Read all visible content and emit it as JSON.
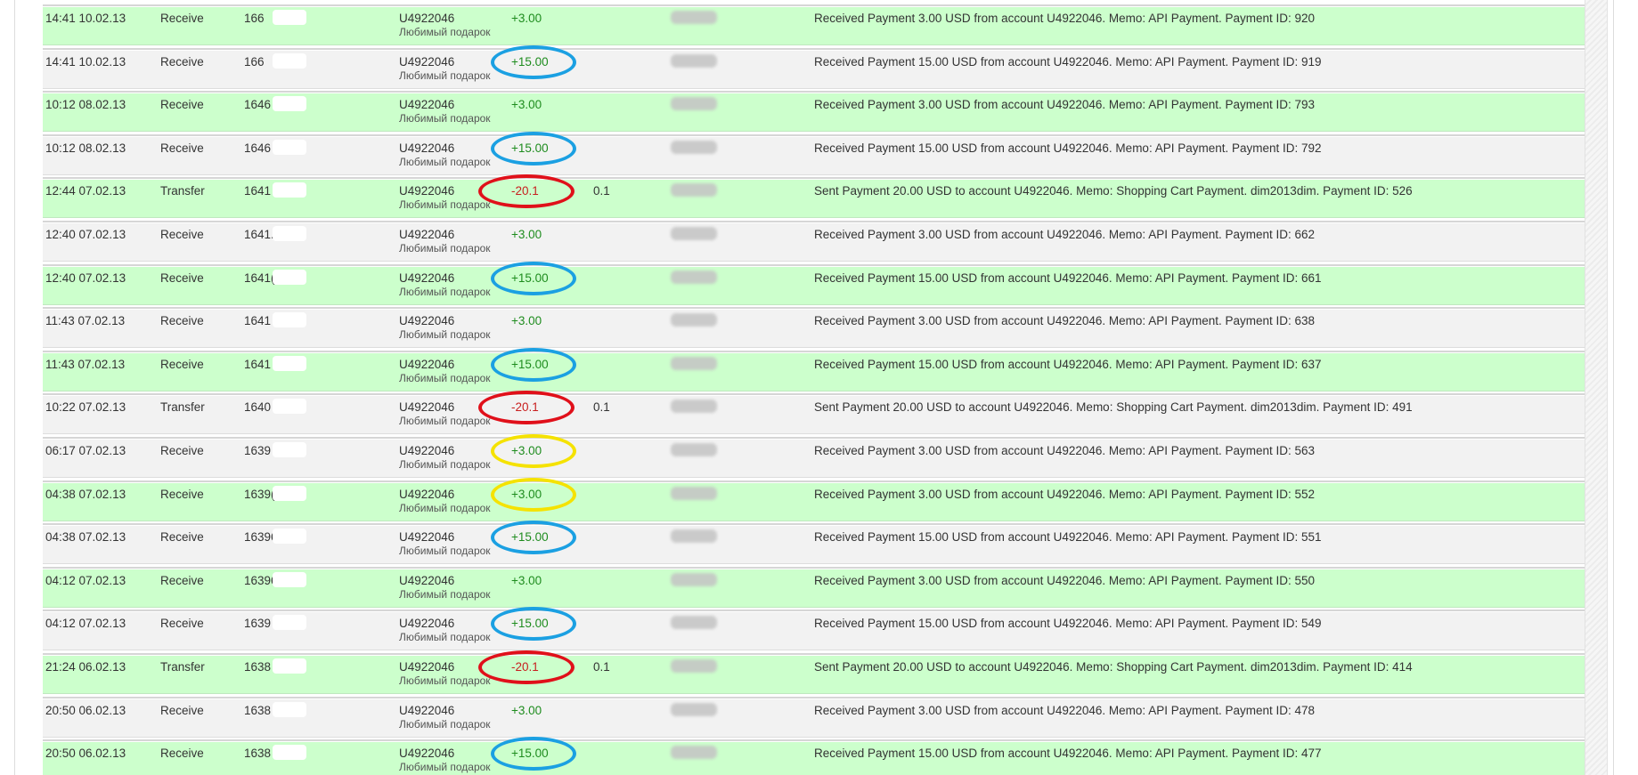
{
  "colors": {
    "row_green": "#ccffcc",
    "row_gray": "#f2f2f2",
    "amount_positive": "#1e8c1e",
    "amount_negative": "#c81e1e",
    "circle_blue": "#1ba0e2",
    "circle_red": "#e0101a",
    "circle_yellow": "#f5e200"
  },
  "rows": [
    {
      "time": "14:41 10.02.13",
      "type": "Receive",
      "batch": "166",
      "account": "U4922046",
      "name": "Любимый подарок",
      "amount": "+3.00",
      "amount_sign": "pos",
      "fee": "",
      "memo": "Received Payment 3.00 USD from account U4922046. Memo: API Payment. Payment ID: 920",
      "circle": "",
      "shade": "green"
    },
    {
      "time": "14:41 10.02.13",
      "type": "Receive",
      "batch": "166",
      "account": "U4922046",
      "name": "Любимый подарок",
      "amount": "+15.00",
      "amount_sign": "pos",
      "fee": "",
      "memo": "Received Payment 15.00 USD from account U4922046. Memo: API Payment. Payment ID: 919",
      "circle": "blue",
      "shade": "gray"
    },
    {
      "time": "10:12 08.02.13",
      "type": "Receive",
      "batch": "1646",
      "account": "U4922046",
      "name": "Любимый подарок",
      "amount": "+3.00",
      "amount_sign": "pos",
      "fee": "",
      "memo": "Received Payment 3.00 USD from account U4922046. Memo: API Payment. Payment ID: 793",
      "circle": "",
      "shade": "green"
    },
    {
      "time": "10:12 08.02.13",
      "type": "Receive",
      "batch": "1646",
      "account": "U4922046",
      "name": "Любимый подарок",
      "amount": "+15.00",
      "amount_sign": "pos",
      "fee": "",
      "memo": "Received Payment 15.00 USD from account U4922046. Memo: API Payment. Payment ID: 792",
      "circle": "blue",
      "shade": "gray"
    },
    {
      "time": "12:44 07.02.13",
      "type": "Transfer",
      "batch": "1641",
      "account": "U4922046",
      "name": "Любимый подарок",
      "amount": "-20.1",
      "amount_sign": "neg",
      "fee": "0.1",
      "memo": "Sent Payment 20.00 USD to account U4922046. Memo: Shopping Cart Payment. dim2013dim. Payment ID: 526",
      "circle": "red",
      "shade": "green"
    },
    {
      "time": "12:40 07.02.13",
      "type": "Receive",
      "batch": "1641.",
      "account": "U4922046",
      "name": "Любимый подарок",
      "amount": "+3.00",
      "amount_sign": "pos",
      "fee": "",
      "memo": "Received Payment 3.00 USD from account U4922046. Memo: API Payment. Payment ID: 662",
      "circle": "",
      "shade": "gray"
    },
    {
      "time": "12:40 07.02.13",
      "type": "Receive",
      "batch": "1641(",
      "account": "U4922046",
      "name": "Любимый подарок",
      "amount": "+15.00",
      "amount_sign": "pos",
      "fee": "",
      "memo": "Received Payment 15.00 USD from account U4922046. Memo: API Payment. Payment ID: 661",
      "circle": "blue",
      "shade": "green"
    },
    {
      "time": "11:43 07.02.13",
      "type": "Receive",
      "batch": "1641",
      "account": "U4922046",
      "name": "Любимый подарок",
      "amount": "+3.00",
      "amount_sign": "pos",
      "fee": "",
      "memo": "Received Payment 3.00 USD from account U4922046. Memo: API Payment. Payment ID: 638",
      "circle": "",
      "shade": "gray"
    },
    {
      "time": "11:43 07.02.13",
      "type": "Receive",
      "batch": "1641",
      "account": "U4922046",
      "name": "Любимый подарок",
      "amount": "+15.00",
      "amount_sign": "pos",
      "fee": "",
      "memo": "Received Payment 15.00 USD from account U4922046. Memo: API Payment. Payment ID: 637",
      "circle": "blue",
      "shade": "green"
    },
    {
      "time": "10:22 07.02.13",
      "type": "Transfer",
      "batch": "1640",
      "account": "U4922046",
      "name": "Любимый подарок",
      "amount": "-20.1",
      "amount_sign": "neg",
      "fee": "0.1",
      "memo": "Sent Payment 20.00 USD to account U4922046. Memo: Shopping Cart Payment. dim2013dim. Payment ID: 491",
      "circle": "red",
      "shade": "gray"
    },
    {
      "time": "06:17 07.02.13",
      "type": "Receive",
      "batch": "1639",
      "account": "U4922046",
      "name": "Любимый подарок",
      "amount": "+3.00",
      "amount_sign": "pos",
      "fee": "",
      "memo": "Received Payment 3.00 USD from account U4922046. Memo: API Payment. Payment ID: 563",
      "circle": "yellow",
      "shade": "gray"
    },
    {
      "time": "04:38 07.02.13",
      "type": "Receive",
      "batch": "1639(",
      "account": "U4922046",
      "name": "Любимый подарок",
      "amount": "+3.00",
      "amount_sign": "pos",
      "fee": "",
      "memo": "Received Payment 3.00 USD from account U4922046. Memo: API Payment. Payment ID: 552",
      "circle": "yellow",
      "shade": "green"
    },
    {
      "time": "04:38 07.02.13",
      "type": "Receive",
      "batch": "16396",
      "account": "U4922046",
      "name": "Любимый подарок",
      "amount": "+15.00",
      "amount_sign": "pos",
      "fee": "",
      "memo": "Received Payment 15.00 USD from account U4922046. Memo: API Payment. Payment ID: 551",
      "circle": "blue",
      "shade": "gray"
    },
    {
      "time": "04:12 07.02.13",
      "type": "Receive",
      "batch": "16396",
      "account": "U4922046",
      "name": "Любимый подарок",
      "amount": "+3.00",
      "amount_sign": "pos",
      "fee": "",
      "memo": "Received Payment 3.00 USD from account U4922046. Memo: API Payment. Payment ID: 550",
      "circle": "",
      "shade": "green"
    },
    {
      "time": "04:12 07.02.13",
      "type": "Receive",
      "batch": "1639",
      "account": "U4922046",
      "name": "Любимый подарок",
      "amount": "+15.00",
      "amount_sign": "pos",
      "fee": "",
      "memo": "Received Payment 15.00 USD from account U4922046. Memo: API Payment. Payment ID: 549",
      "circle": "blue",
      "shade": "gray"
    },
    {
      "time": "21:24 06.02.13",
      "type": "Transfer",
      "batch": "1638",
      "account": "U4922046",
      "name": "Любимый подарок",
      "amount": "-20.1",
      "amount_sign": "neg",
      "fee": "0.1",
      "memo": "Sent Payment 20.00 USD to account U4922046. Memo: Shopping Cart Payment. dim2013dim. Payment ID: 414",
      "circle": "red",
      "shade": "green"
    },
    {
      "time": "20:50 06.02.13",
      "type": "Receive",
      "batch": "1638",
      "account": "U4922046",
      "name": "Любимый подарок",
      "amount": "+3.00",
      "amount_sign": "pos",
      "fee": "",
      "memo": "Received Payment 3.00 USD from account U4922046. Memo: API Payment. Payment ID: 478",
      "circle": "",
      "shade": "gray"
    },
    {
      "time": "20:50 06.02.13",
      "type": "Receive",
      "batch": "1638",
      "account": "U4922046",
      "name": "Любимый подарок",
      "amount": "+15.00",
      "amount_sign": "pos",
      "fee": "",
      "memo": "Received Payment 15.00 USD from account U4922046. Memo: API Payment. Payment ID: 477",
      "circle": "blue",
      "shade": "green"
    }
  ]
}
